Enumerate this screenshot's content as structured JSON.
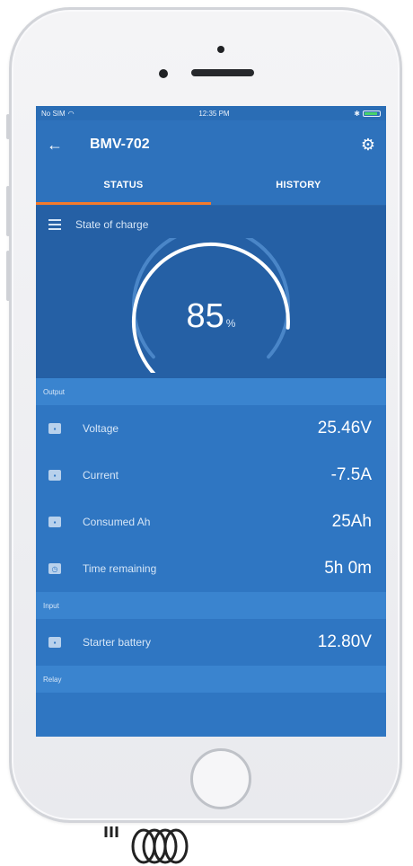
{
  "statusbar": {
    "carrier": "No SIM",
    "time": "12:35 PM",
    "bluetooth": "✱"
  },
  "appbar": {
    "title": "BMV-702",
    "back_icon": "arrow-left-icon",
    "settings_icon": "gear-icon"
  },
  "tabs": [
    {
      "label": "STATUS",
      "active": true
    },
    {
      "label": "HISTORY",
      "active": false
    }
  ],
  "soc": {
    "label": "State of charge",
    "value": "85",
    "unit": "%",
    "level": 0.85
  },
  "sections": {
    "output": "Output",
    "input": "Input",
    "relay": "Relay"
  },
  "output_rows": [
    {
      "label": "Voltage",
      "value": "25.46V"
    },
    {
      "label": "Current",
      "value": "-7.5A"
    },
    {
      "label": "Consumed Ah",
      "value": "25Ah"
    },
    {
      "label": "Time remaining",
      "value": "5h 0m"
    }
  ],
  "input_rows": [
    {
      "label": "Starter battery",
      "value": "12.80V"
    }
  ],
  "colors": {
    "accent": "#f47a2b",
    "primary": "#2f76c2",
    "battery_ok": "#48d36b"
  }
}
